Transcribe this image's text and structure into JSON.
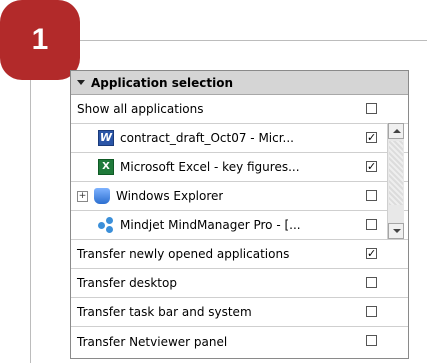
{
  "step": {
    "number": "1"
  },
  "panel": {
    "title": "Application selection",
    "show_all": {
      "label": "Show all applications",
      "checked": false
    },
    "apps": [
      {
        "label": "contract_draft_Oct07 - Micr...",
        "icon": "word-icon",
        "checked": true
      },
      {
        "label": "Microsoft Excel - key figures...",
        "icon": "excel-icon",
        "checked": true
      },
      {
        "label": "Windows Explorer",
        "icon": "windows-explorer-icon",
        "checked": false,
        "expandable": true
      },
      {
        "label": "Mindjet MindManager Pro - [...",
        "icon": "mindmanager-icon",
        "checked": false
      }
    ],
    "options": [
      {
        "label": "Transfer newly opened applications",
        "checked": true
      },
      {
        "label": "Transfer desktop",
        "checked": false
      },
      {
        "label": "Transfer task bar and system",
        "checked": false
      },
      {
        "label": "Transfer Netviewer panel",
        "checked": false
      }
    ]
  },
  "colors": {
    "badge": "#b22a2a",
    "header_bg": "#d5d5d5"
  }
}
